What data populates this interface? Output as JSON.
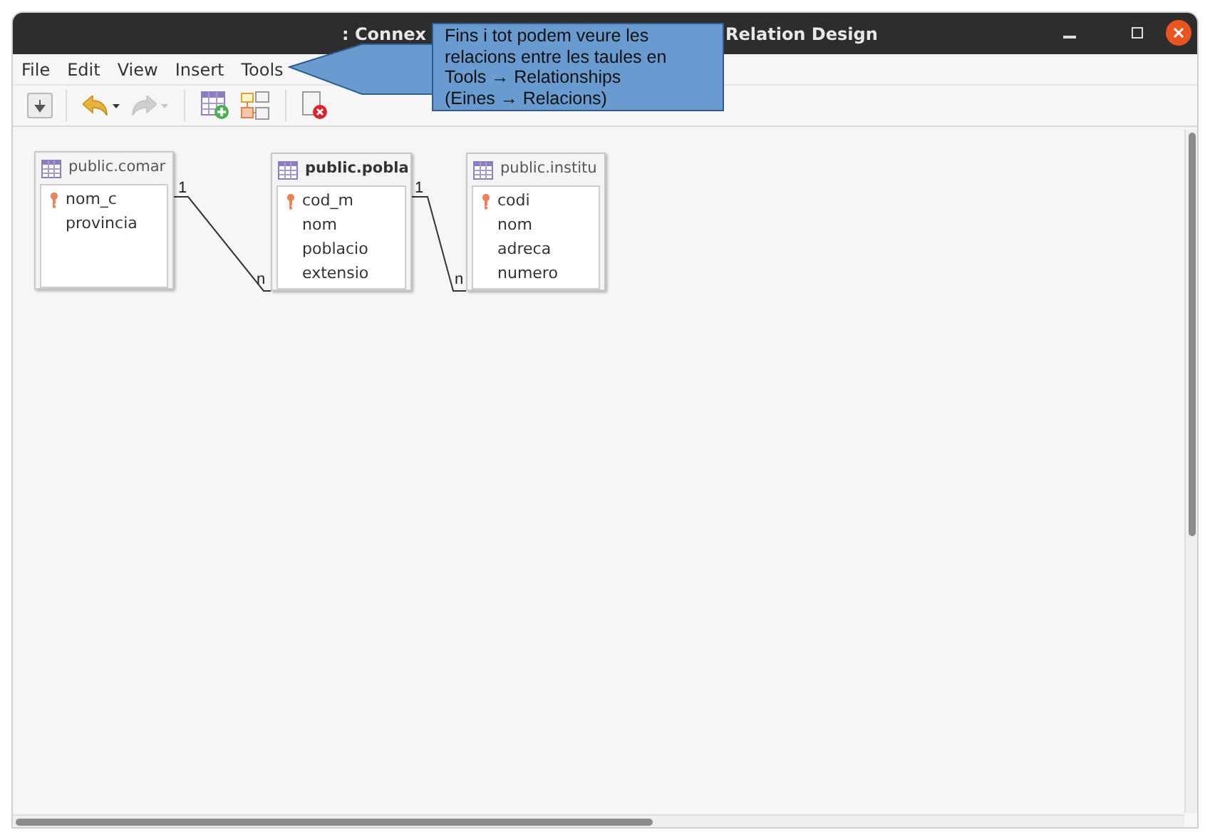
{
  "window": {
    "title_left": ": Connex",
    "title_right": "Relation Design"
  },
  "menu": [
    "File",
    "Edit",
    "View",
    "Insert",
    "Tools"
  ],
  "toolbar": [
    {
      "kind": "save"
    },
    {
      "kind": "sep"
    },
    {
      "kind": "undo",
      "disabled": false
    },
    {
      "kind": "redo",
      "disabled": true
    },
    {
      "kind": "sep"
    },
    {
      "kind": "add-table"
    },
    {
      "kind": "relation"
    },
    {
      "kind": "sep"
    },
    {
      "kind": "delete"
    }
  ],
  "tables": [
    {
      "title": "public.comar",
      "bold": false,
      "fields": [
        {
          "name": "nom_c",
          "key": true
        },
        {
          "name": "provincia",
          "key": false
        }
      ]
    },
    {
      "title": "public.pobla",
      "bold": true,
      "fields": [
        {
          "name": "cod_m",
          "key": true
        },
        {
          "name": "nom",
          "key": false
        },
        {
          "name": "poblacio",
          "key": false
        },
        {
          "name": "extensio",
          "key": false
        }
      ]
    },
    {
      "title": "public.institu",
      "bold": false,
      "fields": [
        {
          "name": "codi",
          "key": true
        },
        {
          "name": "nom",
          "key": false
        },
        {
          "name": "adreca",
          "key": false
        },
        {
          "name": "numero",
          "key": false
        }
      ]
    }
  ],
  "relations": [
    {
      "from": "1",
      "to": "n"
    },
    {
      "from": "1",
      "to": "n"
    }
  ],
  "callout": [
    "Fins i tot podem veure les",
    "relacions entre les taules en",
    "Tools → Relationships",
    "(Eines → Relacions)"
  ]
}
